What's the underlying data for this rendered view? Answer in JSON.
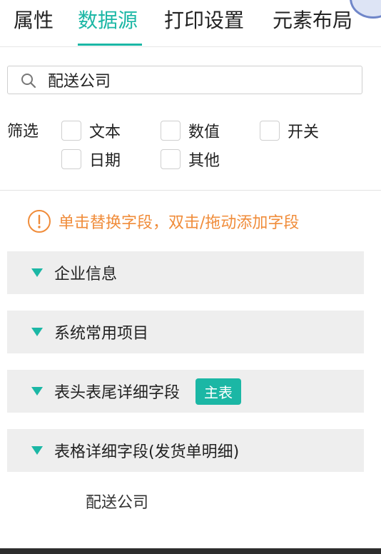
{
  "tabs": [
    {
      "label": "属性",
      "active": false
    },
    {
      "label": "数据源",
      "active": true
    },
    {
      "label": "打印设置",
      "active": false
    },
    {
      "label": "元素布局",
      "active": false
    }
  ],
  "search": {
    "value": "配送公司",
    "icon": "search-icon"
  },
  "filter": {
    "label": "筛选",
    "options": [
      {
        "label": "文本",
        "checked": false
      },
      {
        "label": "数值",
        "checked": false
      },
      {
        "label": "开关",
        "checked": false
      },
      {
        "label": "日期",
        "checked": false
      },
      {
        "label": "其他",
        "checked": false
      }
    ]
  },
  "hint": {
    "text": "单击替换字段，双击/拖动添加字段",
    "icon": "exclamation-circle-icon",
    "color": "#f08c3a"
  },
  "groups": [
    {
      "title": "企业信息",
      "icon": "caret-down-icon"
    },
    {
      "title": "系统常用项目",
      "icon": "caret-down-icon"
    },
    {
      "title": "表头表尾详细字段",
      "badge": "主表",
      "icon": "caret-down-icon"
    },
    {
      "title": "表格详细字段(发货单明细)",
      "icon": "caret-down-icon"
    }
  ],
  "fields": [
    "配送公司"
  ],
  "colors": {
    "accent": "#1bb7a5",
    "warning": "#f08c3a",
    "group_bg": "#eeeeee"
  }
}
